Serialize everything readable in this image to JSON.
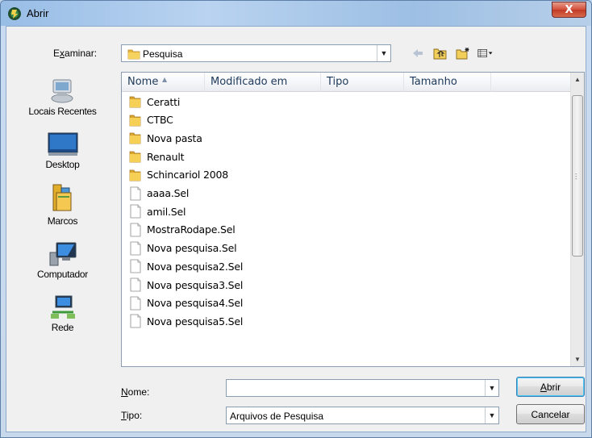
{
  "window": {
    "title": "Abrir",
    "close_glyph": "X"
  },
  "lookin": {
    "label_pre": "E",
    "label_accel": "x",
    "label_post": "aminar:",
    "value": "Pesquisa"
  },
  "places": [
    {
      "label": "Locais Recentes",
      "icon": "recent-places-icon"
    },
    {
      "label": "Desktop",
      "icon": "desktop-icon"
    },
    {
      "label": "Marcos",
      "icon": "libraries-icon"
    },
    {
      "label": "Computador",
      "icon": "computer-icon"
    },
    {
      "label": "Rede",
      "icon": "network-icon"
    }
  ],
  "columns": [
    "Nome",
    "Modificado em",
    "Tipo",
    "Tamanho"
  ],
  "files": [
    {
      "name": "Ceratti",
      "kind": "folder"
    },
    {
      "name": "CTBC",
      "kind": "folder"
    },
    {
      "name": "Nova pasta",
      "kind": "folder"
    },
    {
      "name": "Renault",
      "kind": "folder"
    },
    {
      "name": "Schincariol 2008",
      "kind": "folder"
    },
    {
      "name": "aaaa.Sel",
      "kind": "file"
    },
    {
      "name": "amil.Sel",
      "kind": "file"
    },
    {
      "name": "MostraRodape.Sel",
      "kind": "file"
    },
    {
      "name": "Nova pesquisa.Sel",
      "kind": "file"
    },
    {
      "name": "Nova pesquisa2.Sel",
      "kind": "file"
    },
    {
      "name": "Nova pesquisa3.Sel",
      "kind": "file"
    },
    {
      "name": "Nova pesquisa4.Sel",
      "kind": "file"
    },
    {
      "name": "Nova pesquisa5.Sel",
      "kind": "file"
    }
  ],
  "filename": {
    "label_accel": "N",
    "label_post": "ome:",
    "value": ""
  },
  "filetype": {
    "label_accel": "T",
    "label_post": "ipo:",
    "value": "Arquivos de Pesquisa"
  },
  "buttons": {
    "open_accel": "A",
    "open_post": "brir",
    "cancel": "Cancelar"
  },
  "colors": {
    "title_bar": "#a9c7e8",
    "close_button": "#d3503a",
    "folder": "#e8b83a"
  }
}
